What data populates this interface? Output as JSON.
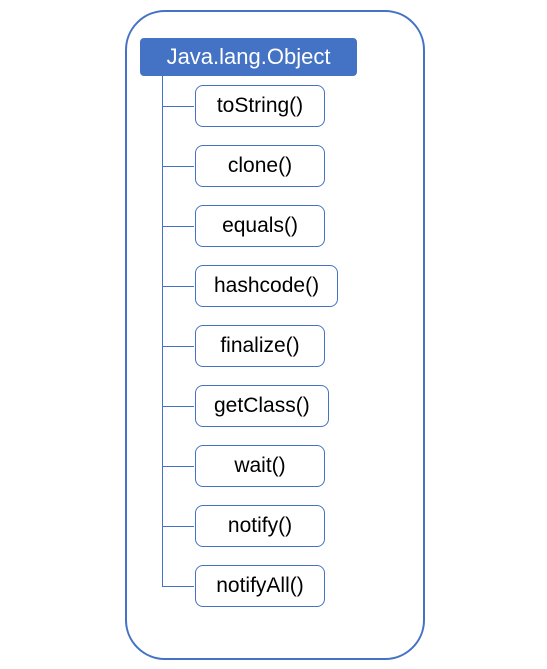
{
  "colors": {
    "accent": "#4472C4",
    "header_text": "#ffffff",
    "method_text": "#000000",
    "background": "#ffffff"
  },
  "class_header": "Java.lang.Object",
  "methods": [
    {
      "label": "toString()"
    },
    {
      "label": "clone()"
    },
    {
      "label": "equals()"
    },
    {
      "label": "hashcode()"
    },
    {
      "label": "finalize()"
    },
    {
      "label": "getClass()"
    },
    {
      "label": "wait()"
    },
    {
      "label": "notify()"
    },
    {
      "label": "notifyAll()"
    }
  ]
}
